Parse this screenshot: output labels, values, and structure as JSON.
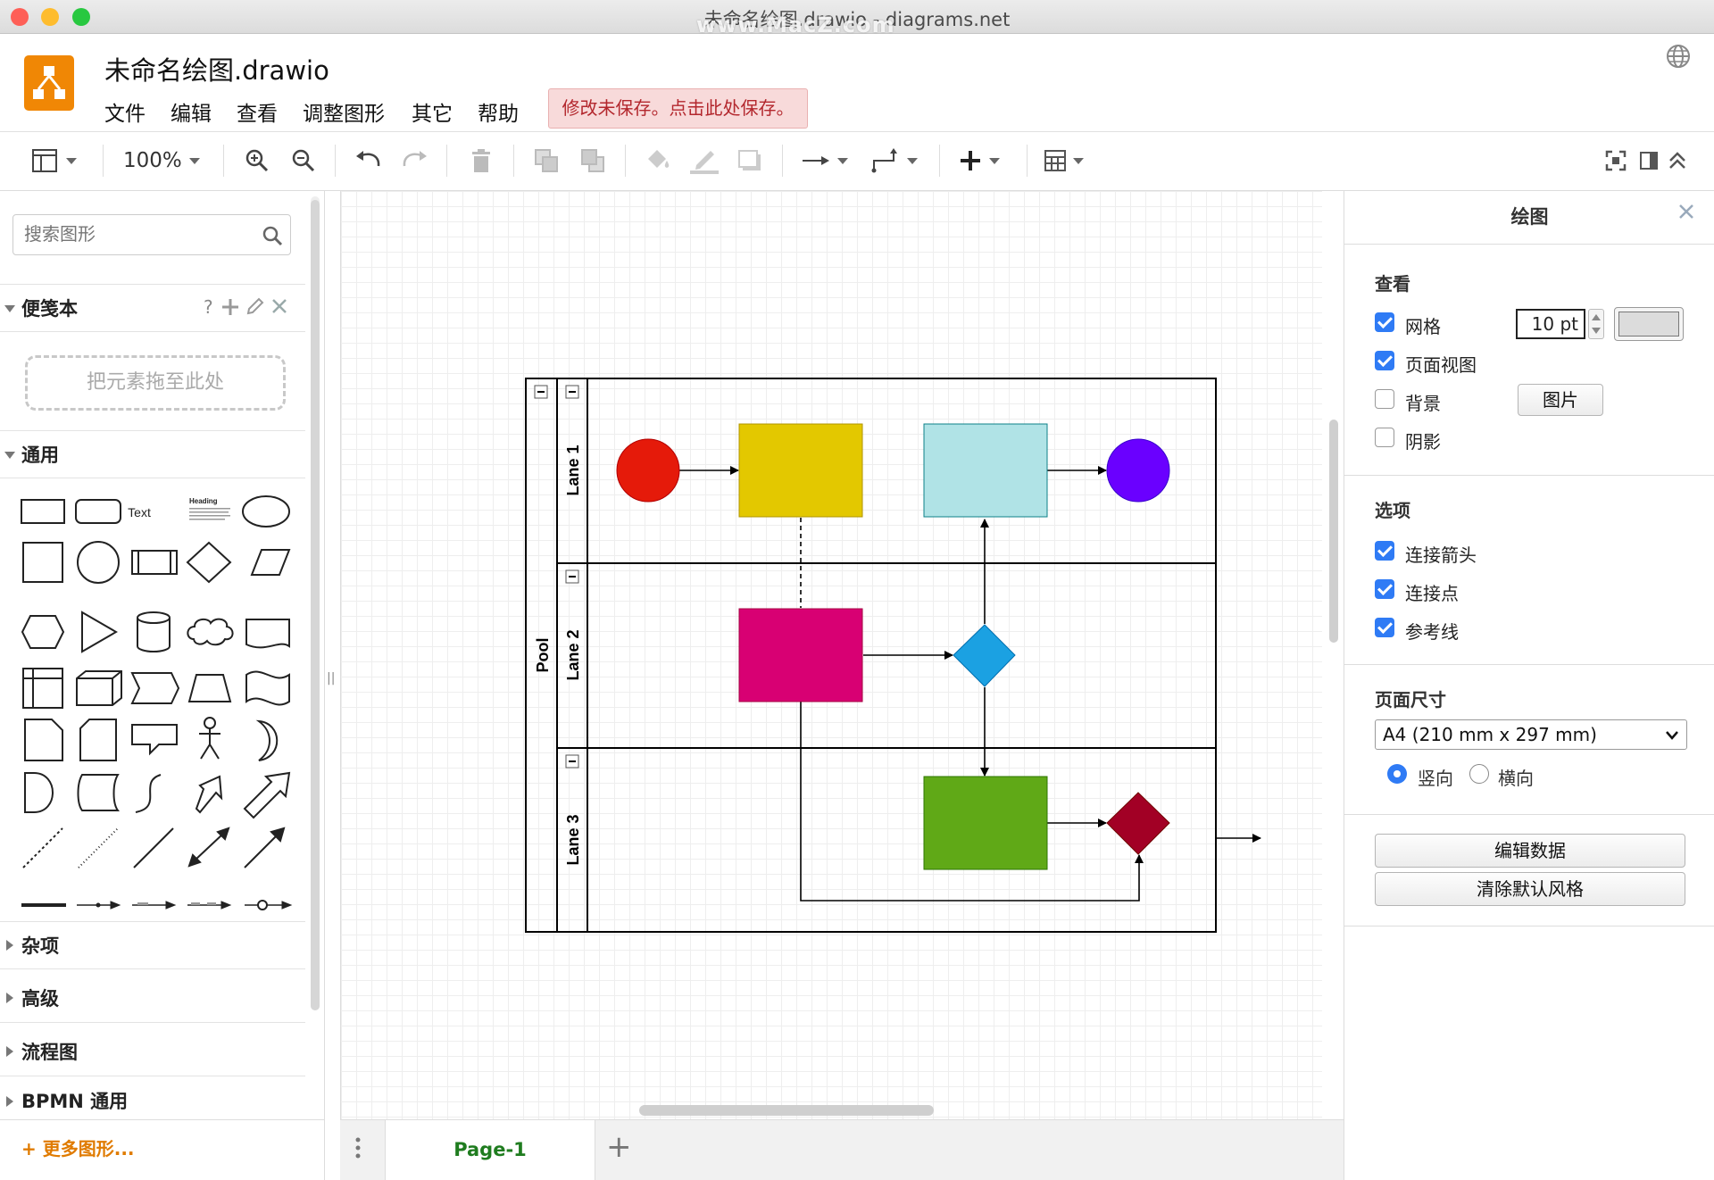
{
  "window": {
    "title": "未命名绘图.drawio - diagrams.net",
    "watermark": "www.MacZ.com"
  },
  "header": {
    "doc_title": "未命名绘图.drawio",
    "menu": [
      "文件",
      "编辑",
      "查看",
      "调整图形",
      "其它",
      "帮助"
    ],
    "unsaved_notice": "修改未保存。点击此处保存。"
  },
  "toolbar": {
    "zoom": "100%"
  },
  "left_panel": {
    "search_placeholder": "搜索图形",
    "scratchpad": {
      "title": "便笺本",
      "help": "?",
      "dropzone": "把元素拖至此处"
    },
    "general": {
      "title": "通用",
      "text_shape": "Text",
      "heading_shape": "Heading"
    },
    "sections": [
      "杂项",
      "高级",
      "流程图",
      "BPMN 通用"
    ],
    "more_shapes": "+ 更多图形..."
  },
  "diagram": {
    "pool_label": "Pool",
    "lanes": [
      "Lane 1",
      "Lane 2",
      "Lane 3"
    ],
    "colors": {
      "start": "#e51a0a",
      "yellow": "#e3c800",
      "cyan": "#b0e3e6",
      "end": "#6a00ff",
      "magenta": "#d80073",
      "diamond_blue": "#1ba1e2",
      "green": "#60a917",
      "diamond_red": "#a20025"
    }
  },
  "page_tabs": {
    "tabs": [
      "Page-1"
    ],
    "add_icon": "+"
  },
  "right_panel": {
    "title": "绘图",
    "view_section": "查看",
    "grid_label": "网格",
    "grid_size": "10 pt",
    "page_view_label": "页面视图",
    "background_label": "背景",
    "image_button": "图片",
    "shadow_label": "阴影",
    "options_section": "选项",
    "connection_arrows": "连接箭头",
    "connection_points": "连接点",
    "guides": "参考线",
    "page_size_section": "页面尺寸",
    "page_size_value": "A4 (210 mm x 297 mm)",
    "portrait": "竖向",
    "landscape": "横向",
    "edit_data_button": "编辑数据",
    "clear_style_button": "清除默认风格"
  }
}
